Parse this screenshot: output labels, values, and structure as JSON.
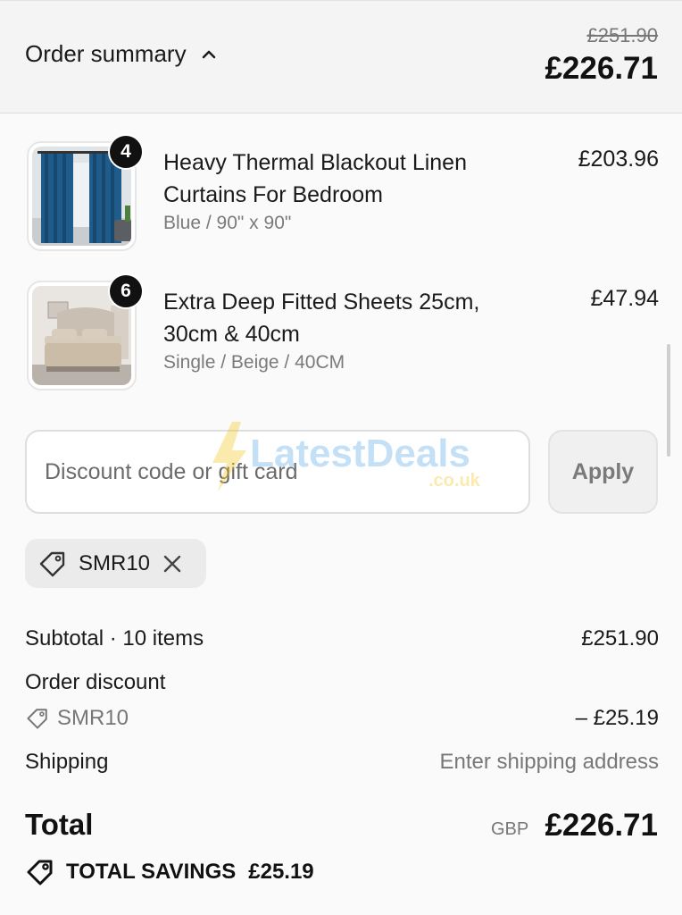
{
  "header": {
    "toggle_label": "Order summary",
    "original_total": "£251.90",
    "discounted_total": "£226.71"
  },
  "items": [
    {
      "title": "Heavy Thermal Blackout Linen Curtains For Bedroom",
      "variant": "Blue / 90\" x 90\"",
      "price": "£203.96",
      "quantity": "4",
      "image": "curtains-image"
    },
    {
      "title": "Extra Deep Fitted Sheets 25cm, 30cm & 40cm",
      "variant": "Single / Beige / 40CM",
      "price": "£47.94",
      "quantity": "6",
      "image": "fitted-sheet-image"
    }
  ],
  "discount": {
    "placeholder": "Discount code or gift card",
    "apply_label": "Apply",
    "applied_code": "SMR10"
  },
  "watermark": {
    "brand": "LatestDeals",
    "suffix": ".co.uk"
  },
  "totals": {
    "subtotal_label": "Subtotal · 10 items",
    "subtotal_value": "£251.90",
    "order_discount_label": "Order discount",
    "discount_code": "SMR10",
    "discount_value": "– £25.19",
    "shipping_label": "Shipping",
    "shipping_value": "Enter shipping address",
    "total_label": "Total",
    "currency": "GBP",
    "total_value": "£226.71",
    "savings_label": "TOTAL SAVINGS",
    "savings_value": "£25.19"
  },
  "colors": {
    "background": "#fafafa",
    "header_background": "#f4f4f4",
    "text": "#1a1a1a",
    "muted": "#777777",
    "badge": "#111111"
  }
}
